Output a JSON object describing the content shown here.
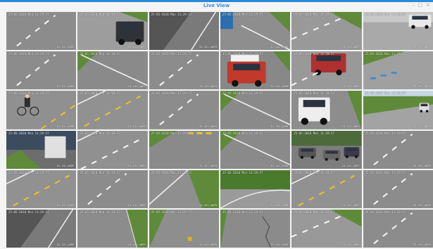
{
  "window": {
    "title": "Live View",
    "controls": [
      "–",
      "□",
      "×"
    ]
  },
  "camera_osd": {
    "timestamp": "25-05-2018 Mon 11:29:57",
    "camera_id": "ID-101-ANPR"
  },
  "colors": {
    "accent": "#2a8ad6",
    "selected_border": "#d7b24a",
    "road": "#8f8f8f",
    "grass": "#5f8a3a",
    "lane_yellow": "#e8c22a"
  },
  "tiles": [
    {
      "scene": "road-dashed"
    },
    {
      "scene": "road-car-dark"
    },
    {
      "scene": "road-shadow"
    },
    {
      "scene": "road-bus"
    },
    {
      "scene": "road-grass"
    },
    {
      "scene": "road-van"
    },
    {
      "scene": "road-dashed"
    },
    {
      "scene": "road-edge"
    },
    {
      "scene": "road-dashed"
    },
    {
      "scene": "road-truck-white"
    },
    {
      "scene": "road-car-red"
    },
    {
      "scene": "road-crossing"
    },
    {
      "scene": "road-cyclist"
    },
    {
      "scene": "road-yellow"
    },
    {
      "scene": "road-dashed"
    },
    {
      "scene": "road-edge"
    },
    {
      "scene": "road-car-white"
    },
    {
      "scene": "road-field"
    },
    {
      "scene": "street-truck"
    },
    {
      "scene": "road-yellow-selected"
    },
    {
      "scene": "road-yellow-top"
    },
    {
      "scene": "road-edge"
    },
    {
      "scene": "parking-cars"
    },
    {
      "scene": "road-dashed"
    },
    {
      "scene": "road-yellow"
    },
    {
      "scene": "road-dashed"
    },
    {
      "scene": "road-grass-right"
    },
    {
      "scene": "road-curve-trees"
    },
    {
      "scene": "road-yellow"
    },
    {
      "scene": "road-dashed"
    },
    {
      "scene": "road-shadow"
    },
    {
      "scene": "road-grass-curb"
    },
    {
      "scene": "road-barrier"
    },
    {
      "scene": "road-crack"
    },
    {
      "scene": "road-grass"
    },
    {
      "scene": "road-dashed"
    }
  ]
}
